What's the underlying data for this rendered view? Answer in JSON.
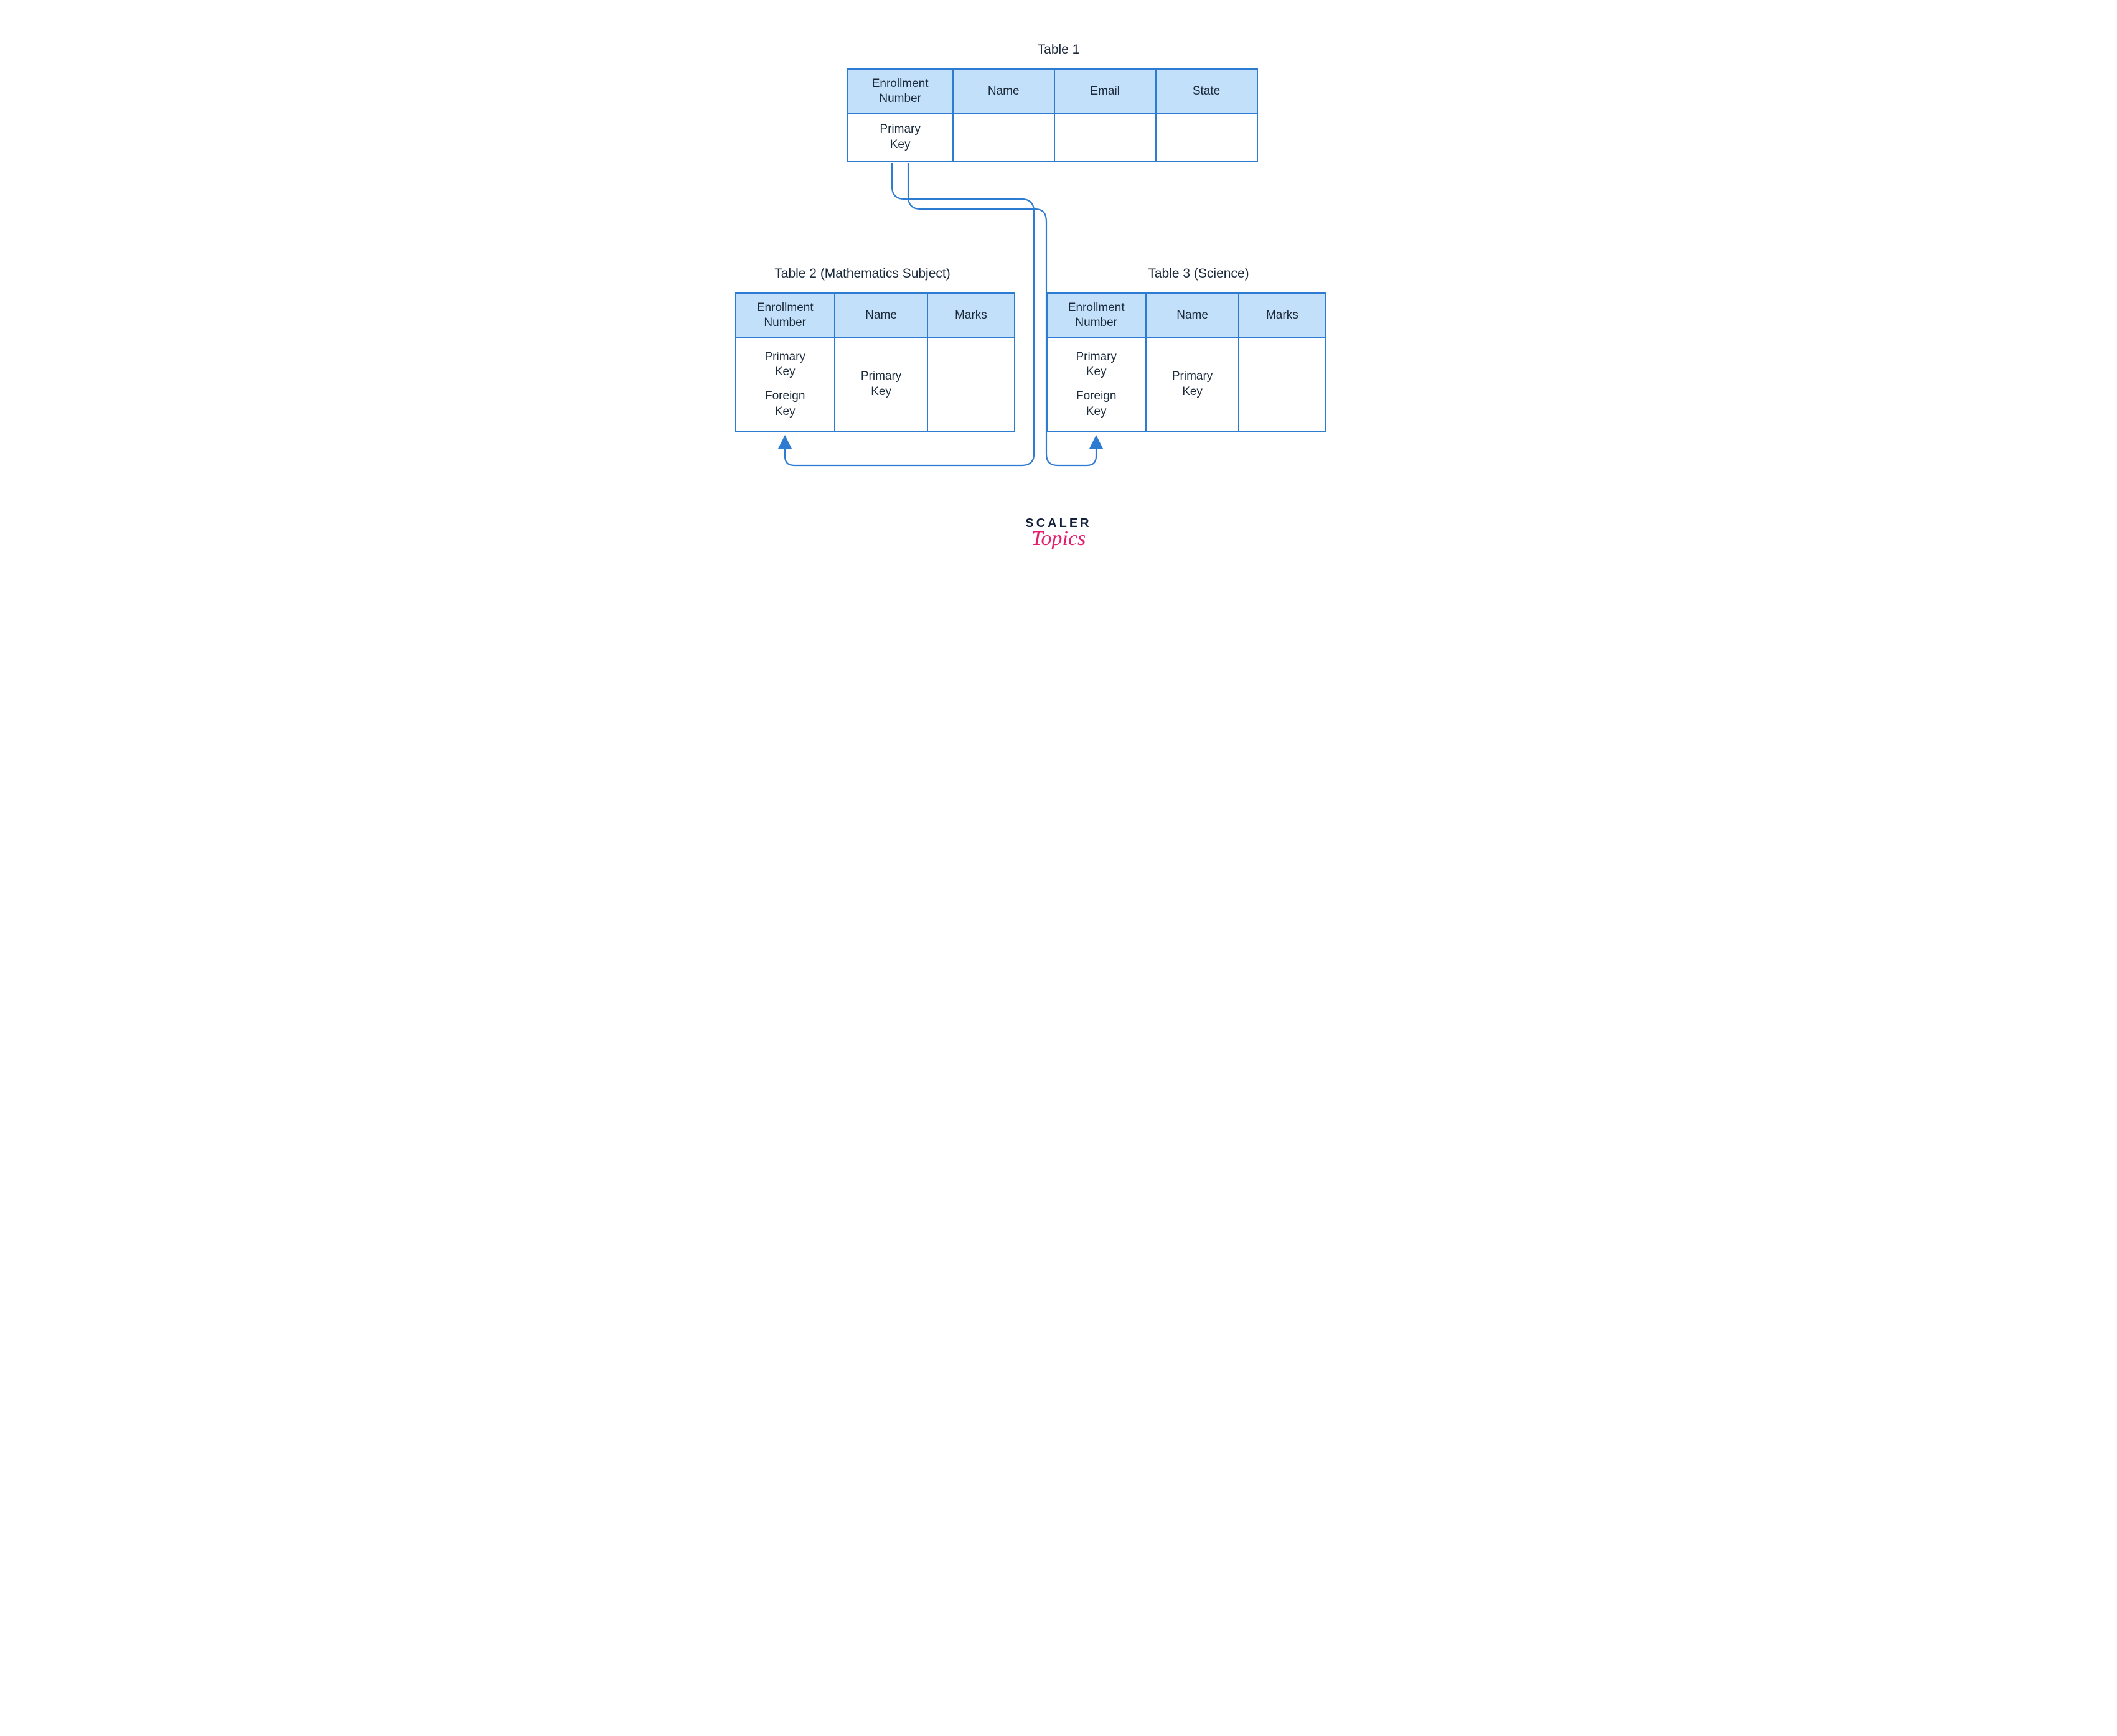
{
  "colors": {
    "border": "#2d7cd1",
    "headerFill": "#c3e0fa",
    "text": "#1b2a3a",
    "logoMain": "#13203a",
    "logoAccent": "#e4206e"
  },
  "table1": {
    "caption": "Table 1",
    "headers": [
      "Enrollment Number",
      "Name",
      "Email",
      "State"
    ],
    "row1": [
      "Primary Key",
      "",
      "",
      ""
    ]
  },
  "table2": {
    "caption": "Table 2 (Mathematics Subject)",
    "headers": [
      "Enrollment Number",
      "Name",
      "Marks"
    ],
    "row1": {
      "col1_line1": "Primary Key",
      "col1_line2": "Foreign Key",
      "col2": "Primary Key",
      "col3": ""
    }
  },
  "table3": {
    "caption": "Table 3 (Science)",
    "headers": [
      "Enrollment Number",
      "Name",
      "Marks"
    ],
    "row1": {
      "col1_line1": "Primary Key",
      "col1_line2": "Foreign Key",
      "col2": "Primary Key",
      "col3": ""
    }
  },
  "logo": {
    "line1": "SCALER",
    "line2": "Topics"
  },
  "relationships": [
    "Table1.EnrollmentNumber → Table2.EnrollmentNumber (foreign key)",
    "Table1.EnrollmentNumber → Table3.EnrollmentNumber (foreign key)"
  ]
}
